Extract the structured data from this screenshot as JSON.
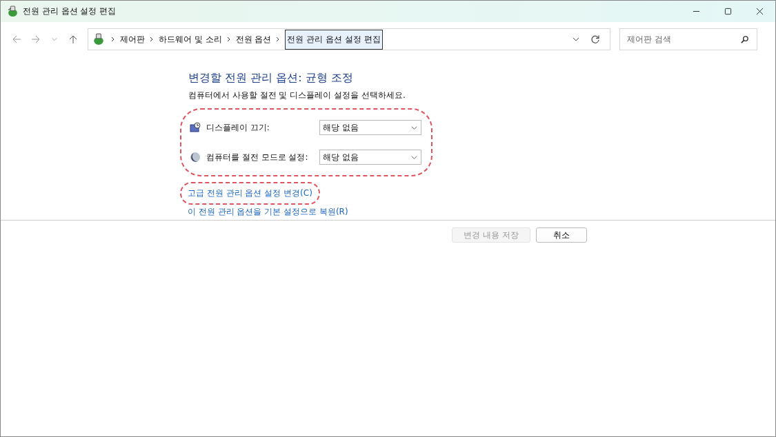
{
  "window": {
    "title": "전원 관리 옵션 설정 편집"
  },
  "breadcrumb": {
    "items": [
      "제어판",
      "하드웨어 및 소리",
      "전원 옵션"
    ],
    "current": "전원 관리 옵션 설정 편집"
  },
  "search": {
    "placeholder": "제어판 검색"
  },
  "heading": "변경할 전원 관리 옵션: 균형 조정",
  "description": "컴퓨터에서 사용할 절전 및 디스플레이 설정을 선택하세요.",
  "settings": {
    "highlighted": true,
    "rows": [
      {
        "kind": "display",
        "label": "디스플레이 끄기:",
        "value": "해당 없음"
      },
      {
        "kind": "sleep",
        "label": "컴퓨터를 절전 모드로 설정:",
        "value": "해당 없음"
      }
    ]
  },
  "links": [
    {
      "label": "고급 전원 관리 옵션 설정 변경(C)",
      "highlighted": true
    },
    {
      "label": "이 전원 관리 옵션을 기본 설정으로 복원(R)",
      "highlighted": false
    }
  ],
  "buttons": [
    {
      "label": "변경 내용 저장",
      "disabled": true
    },
    {
      "label": "취소",
      "disabled": false
    }
  ]
}
